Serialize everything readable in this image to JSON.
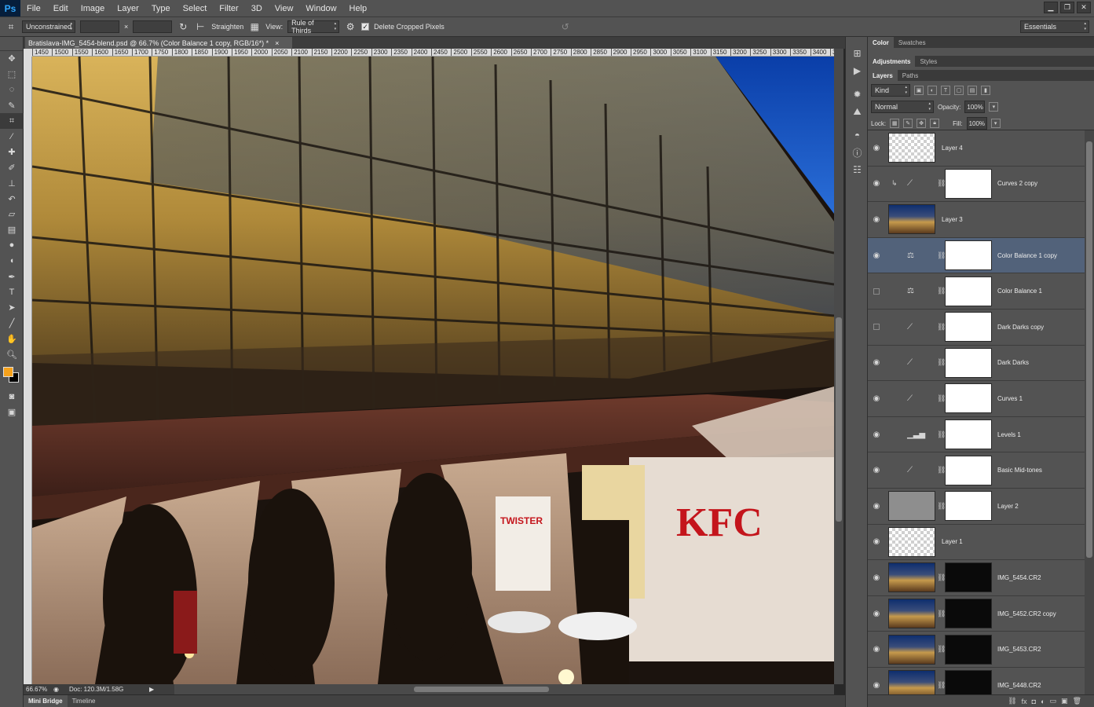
{
  "app": {
    "logo": "Ps"
  },
  "menu": [
    "File",
    "Edit",
    "Image",
    "Layer",
    "Type",
    "Select",
    "Filter",
    "3D",
    "View",
    "Window",
    "Help"
  ],
  "window_controls": [
    "minimize-icon",
    "restore-icon",
    "close-icon"
  ],
  "options": {
    "ratio": "Unconstrained",
    "x_sep": "×",
    "straighten": "Straighten",
    "view_label": "View:",
    "view_value": "Rule of Thirds",
    "delete_cropped": "Delete Cropped Pixels",
    "delete_cropped_checked": true,
    "workspace": "Essentials"
  },
  "document": {
    "tab_title": "Bratislava-IMG_5454-blend.psd @ 66.7% (Color Balance 1 copy, RGB/16*) *",
    "close": "×",
    "ruler_top": [
      "1450",
      "1500",
      "1550",
      "1600",
      "1650",
      "1700",
      "1750",
      "1800",
      "1850",
      "1900",
      "1950",
      "2000",
      "2050",
      "2100",
      "2150",
      "2200",
      "2250",
      "2300",
      "2350",
      "2400",
      "2450",
      "2500",
      "2550",
      "2600",
      "2650",
      "2700",
      "2750",
      "2800",
      "2850",
      "2900",
      "2950",
      "3000",
      "3050",
      "3100",
      "3150",
      "3200",
      "3250",
      "3300",
      "3350",
      "3400",
      "3450"
    ],
    "zoom": "66.67%",
    "doc_info": "Doc: 120.3M/1.58G"
  },
  "bottom_tabs": [
    "Mini Bridge",
    "Timeline"
  ],
  "panels": {
    "top_tabs": [
      "Color",
      "Swatches"
    ],
    "mid_tabs": [
      "Adjustments",
      "Styles"
    ],
    "layer_tabs": [
      "Layers",
      "Paths"
    ],
    "kind": "Kind",
    "blend_mode": "Normal",
    "opacity_label": "Opacity:",
    "opacity": "100%",
    "lock_label": "Lock:",
    "fill_label": "Fill:",
    "fill": "100%"
  },
  "layers": [
    {
      "name": "Layer 4",
      "visible": true,
      "type": "pixel"
    },
    {
      "name": "Curves 2 copy",
      "visible": true,
      "type": "curves",
      "clipped": true
    },
    {
      "name": "Layer 3",
      "visible": true,
      "type": "photo"
    },
    {
      "name": "Color Balance 1 copy",
      "visible": true,
      "type": "balance",
      "selected": true
    },
    {
      "name": "Color Balance 1",
      "visible": false,
      "type": "balance"
    },
    {
      "name": "Dark Darks copy",
      "visible": false,
      "type": "curves"
    },
    {
      "name": "Dark Darks",
      "visible": true,
      "type": "curves"
    },
    {
      "name": "Curves 1",
      "visible": true,
      "type": "curves"
    },
    {
      "name": "Levels 1",
      "visible": true,
      "type": "levels"
    },
    {
      "name": "Basic Mid-tones",
      "visible": true,
      "type": "curves"
    },
    {
      "name": "Layer 2",
      "visible": true,
      "type": "masked"
    },
    {
      "name": "Layer 1",
      "visible": true,
      "type": "pixel"
    },
    {
      "name": "IMG_5454.CR2",
      "visible": true,
      "type": "photo"
    },
    {
      "name": "IMG_5452.CR2 copy",
      "visible": true,
      "type": "photo"
    },
    {
      "name": "IMG_5453.CR2",
      "visible": true,
      "type": "photo"
    },
    {
      "name": "IMG_5448.CR2",
      "visible": true,
      "type": "photo"
    }
  ],
  "colors": {
    "accent": "#f6a21c",
    "selected_layer": "#52627a",
    "panel": "#535353"
  }
}
